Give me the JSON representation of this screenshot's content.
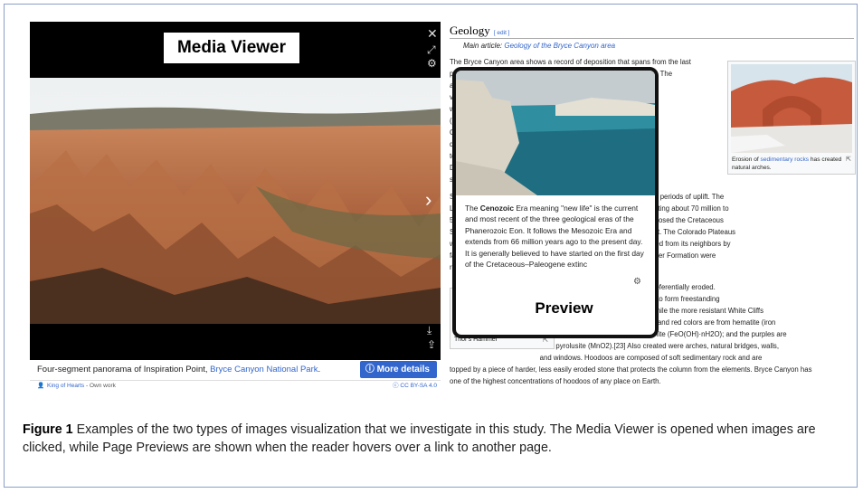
{
  "media_viewer": {
    "label": "Media Viewer",
    "caption_pre": "Four-segment panorama of Inspiration Point, ",
    "caption_link": "Bryce Canyon National Park",
    "caption_post": ".",
    "more_details": "More details",
    "author": "King of Hearts",
    "author_suffix": " - Own work",
    "license": "CC BY-SA 4.0",
    "icons": [
      "close-icon",
      "fullscreen-icon",
      "settings-icon",
      "next-icon",
      "download-icon",
      "share-icon"
    ]
  },
  "article": {
    "heading": "Geology",
    "edit": "[ edit ]",
    "main_article_label": "Main article: ",
    "main_article_link": "Geology of the Bryce Canyon area",
    "p1_lines": [
      "The Bryce Canyon area shows a record of deposition that spans from the last",
      "part of the Cretaceous period and the first half of the Cenozoic era. The",
      "ancient                                          is now the park",
      "varied. T                                           eposited in the",
      "warm, sh                                         ceous Seaway",
      "(outcrop                                         .[22] The colorful",
      "Claron F                                         re carved, was laid",
      "down as                                          at existed from 63",
      "to about                                         cene epochs).",
      "Different                                        ned and became",
      "shallow"
    ],
    "p2_lines": [
      "Several                                          eroded away following two major periods of uplift. The",
      "Laramid                                          ould become North America starting about 70 million to",
      "50 millio                                        y Mountains and in the process closed the Cretaceous",
      "Seaway.                                          nations were victims of this uplift. The Colorado Plateaus",
      "were upl                                         different plateaus, each separated from its neighbors by",
      "faults an                                        Conglomerate and the Sevier River Formation were",
      "removed"
    ],
    "p3_lines": [
      "                                              ertical joints, which over time were preferentially eroded.",
      "                                              of the Claron Formation were eroded to form freestanding",
      "                                              nacles in badlands called hoodoos, while the more resistant White Cliffs",
      "                                              formed monoliths.[4] The brown, pink and red colors are from hematite (iron",
      "                                              oxide; Fe2O3); the yellows from limonite (FeO(OH)·nH2O); and the purples are",
      "                                              from pyrolusite (MnO2).[23] Also created were arches, natural bridges, walls,",
      "                                              and windows. Hoodoos are composed of soft sedimentary rock and are",
      "topped by a piece of harder, less easily eroded stone that protects the column from the elements. Bryce Canyon has",
      "one of the highest concentrations of hoodoos of any place on Earth."
    ],
    "thumb1_caption_pre": "Erosion of ",
    "thumb1_caption_link": "sedimentary rocks",
    "thumb1_caption_post": " has created natural arches.",
    "thumb2_caption": "Thor's Hammer"
  },
  "preview": {
    "label": "Preview",
    "text_pre": "The ",
    "text_bold": "Cenozoic",
    "text_post": " Era meaning \"new life\" is the current and most recent of the three geological eras of the Phanerozoic Eon. It follows the Mesozoic Era and extends from 66 million years ago to the present day. It is generally believed to have started on the first day of the Cretaceous–Paleogene extinc"
  },
  "figure": {
    "label": "Figure 1",
    "text": "  Examples of the two types of images visualization that we investigate in this study. The Media Viewer is opened when images are clicked, while Page Previews are shown when the reader hovers over a link to another page."
  },
  "colors": {
    "link": "#3366cc",
    "button": "#3366cc",
    "frame": "#8aa0c8"
  }
}
